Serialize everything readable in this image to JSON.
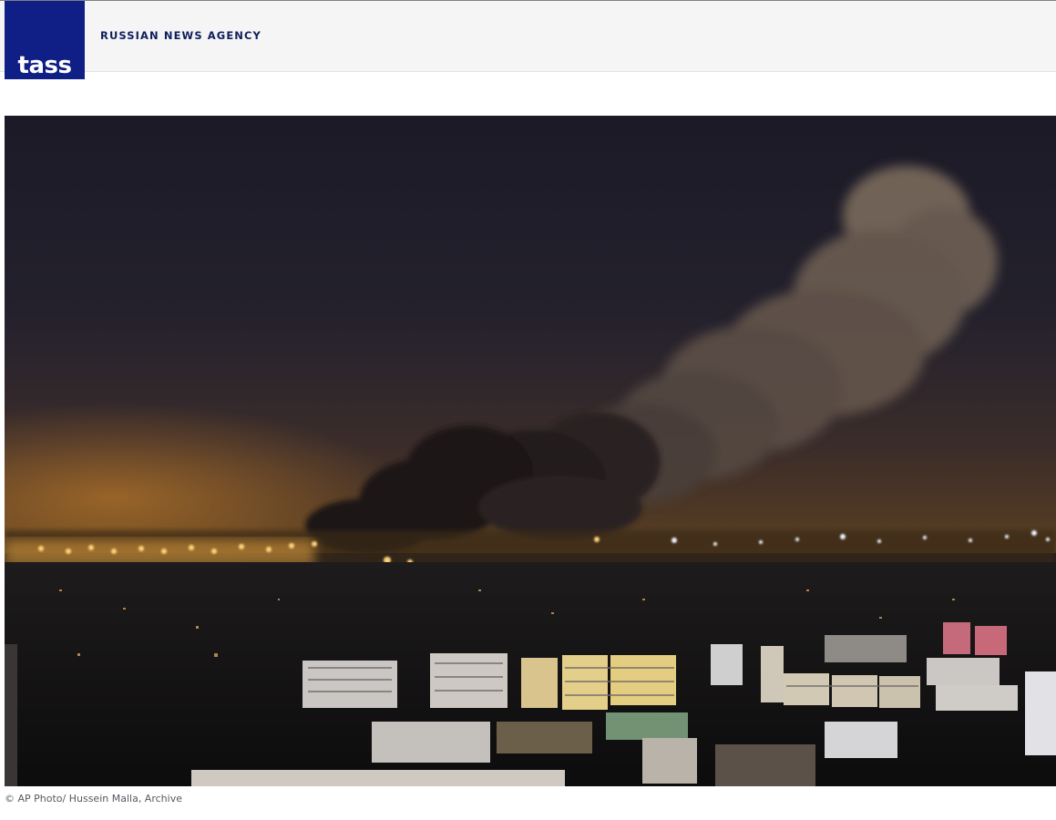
{
  "header": {
    "logo_text": "TASS",
    "agency_name": "RUSSIAN NEWS AGENCY"
  },
  "photo": {
    "description_icon": "night-city-smoke-photo",
    "caption": "© AP Photo/ Hussein Malla, Archive"
  },
  "colors": {
    "brand_blue": "#0f1f85",
    "header_bg": "#f5f5f6",
    "caption_text": "#555a60"
  }
}
